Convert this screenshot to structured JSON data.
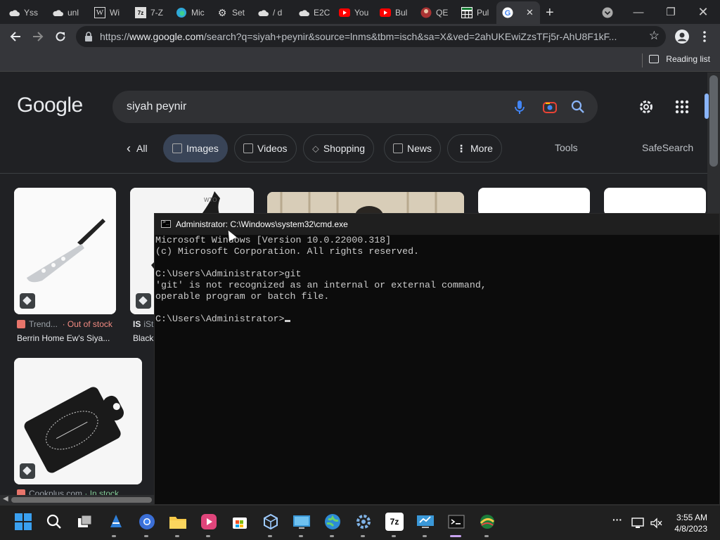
{
  "browser": {
    "tabs": [
      {
        "label": "Yss",
        "icon": "cloud-icon"
      },
      {
        "label": "unl",
        "icon": "cloud-icon"
      },
      {
        "label": "Wi",
        "icon": "wikipedia-icon"
      },
      {
        "label": "7-Z",
        "icon": "7zip-icon"
      },
      {
        "label": "Mic",
        "icon": "edge-icon"
      },
      {
        "label": "Set",
        "icon": "gear-icon"
      },
      {
        "label": "/ d",
        "icon": "cloud-icon"
      },
      {
        "label": "E2C",
        "icon": "cloud-icon"
      },
      {
        "label": "You",
        "icon": "youtube-icon"
      },
      {
        "label": "Bul",
        "icon": "youtube-icon"
      },
      {
        "label": "QE",
        "icon": "avatar-icon"
      },
      {
        "label": "Pul",
        "icon": "grid-icon"
      },
      {
        "label": "",
        "icon": "google-icon",
        "active": true
      }
    ],
    "url_scheme": "https://",
    "url_host": "www.google.com",
    "url_rest": "/search?q=siyah+peynir&source=lnms&tbm=isch&sa=X&ved=2ahUKEwiZzsTFj5r-AhU8F1kF...",
    "reading_list": "Reading list"
  },
  "google": {
    "logo": "Google",
    "query": "siyah peynir",
    "chips": [
      {
        "label": "All"
      },
      {
        "label": "Images"
      },
      {
        "label": "Videos"
      },
      {
        "label": "Shopping"
      },
      {
        "label": "News"
      },
      {
        "label": "More"
      }
    ],
    "tools": "Tools",
    "safesearch": "SafeSearch",
    "results": [
      {
        "source": "Trend...",
        "status": "· Out of stock",
        "caption": "Berrin Home Ew's Siya..."
      },
      {
        "source": "iSt",
        "caption": "Black"
      },
      {
        "source": "Cookplus.com",
        "status": "· In stock"
      }
    ]
  },
  "cmd": {
    "title": "Administrator: C:\\Windows\\system32\\cmd.exe",
    "lines": [
      "Microsoft Windows [Version 10.0.22000.318]",
      "(c) Microsoft Corporation. All rights reserved.",
      "",
      "C:\\Users\\Administrator>git",
      "'git' is not recognized as an internal or external command,",
      "operable program or batch file.",
      ""
    ],
    "prompt": "C:\\Users\\Administrator>"
  },
  "taskbar": {
    "time": "3:55 AM",
    "date": "4/8/2023",
    "apps": [
      "start",
      "search",
      "task-view",
      "vlc",
      "chrome",
      "file-explorer",
      "media-player",
      "store",
      "virtualbox",
      "remote-desktop",
      "globe",
      "settings",
      "7zip",
      "network-monitor",
      "terminal",
      "other"
    ]
  },
  "colors": {
    "accent": "#8ab4f8",
    "chip_selected": "#394457",
    "out_of_stock": "#f28b82",
    "in_stock": "#81c995"
  }
}
